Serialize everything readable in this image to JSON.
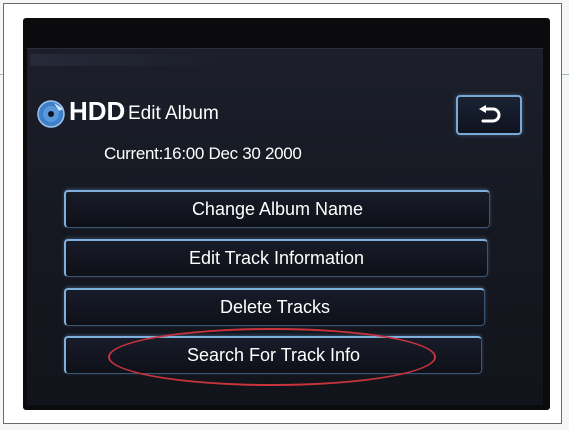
{
  "header": {
    "source_label": "HDD",
    "screen_title": "Edit Album",
    "current_time": "Current:16:00 Dec 30 2000"
  },
  "back_button": {
    "icon": "back-arrow-icon"
  },
  "menu": {
    "items": [
      {
        "label": "Change Album Name"
      },
      {
        "label": "Edit Track Information"
      },
      {
        "label": "Delete Tracks"
      },
      {
        "label": "Search For Track Info"
      }
    ]
  },
  "colors": {
    "screen_background": "#161922",
    "button_border": "#7fb0dd",
    "highlight_annotation": "#c8343c",
    "text": "#ffffff"
  }
}
